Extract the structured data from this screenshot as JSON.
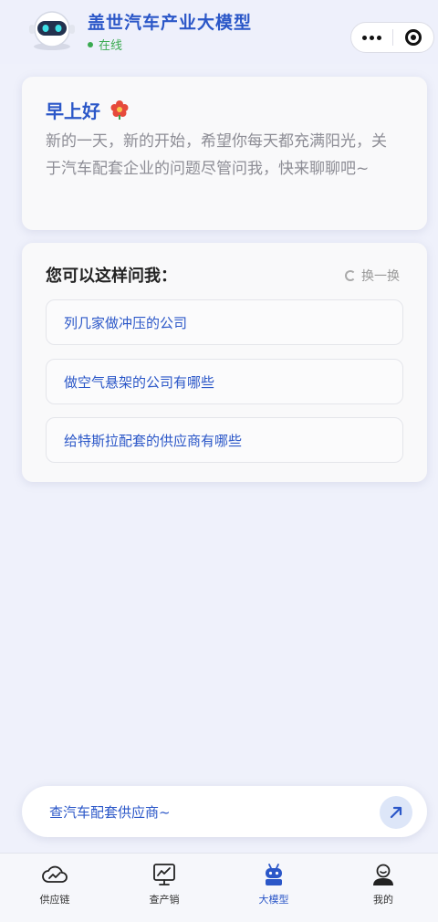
{
  "header": {
    "title": "盖世汽车产业大模型",
    "status": "在线",
    "avatar_icon": "robot-avatar-icon"
  },
  "greeting": {
    "title": "早上好",
    "emoji": "flower-icon",
    "text": "新的一天，新的开始，希望你每天都充满阳光，关于汽车配套企业的问题尽管问我，快来聊聊吧~"
  },
  "ask": {
    "title": "您可以这样问我：",
    "refresh_label": "换一换",
    "suggestions": [
      "列几家做冲压的公司",
      "做空气悬架的公司有哪些",
      "给特斯拉配套的供应商有哪些"
    ]
  },
  "input": {
    "placeholder": "查汽车配套供应商~"
  },
  "tabs": [
    {
      "label": "供应链",
      "icon": "cloud-chart-icon"
    },
    {
      "label": "查产销",
      "icon": "monitor-chart-icon"
    },
    {
      "label": "大模型",
      "icon": "android-robot-icon"
    },
    {
      "label": "我的",
      "icon": "user-icon"
    }
  ],
  "colors": {
    "accent": "#2b57c8",
    "online": "#3aaa50"
  }
}
